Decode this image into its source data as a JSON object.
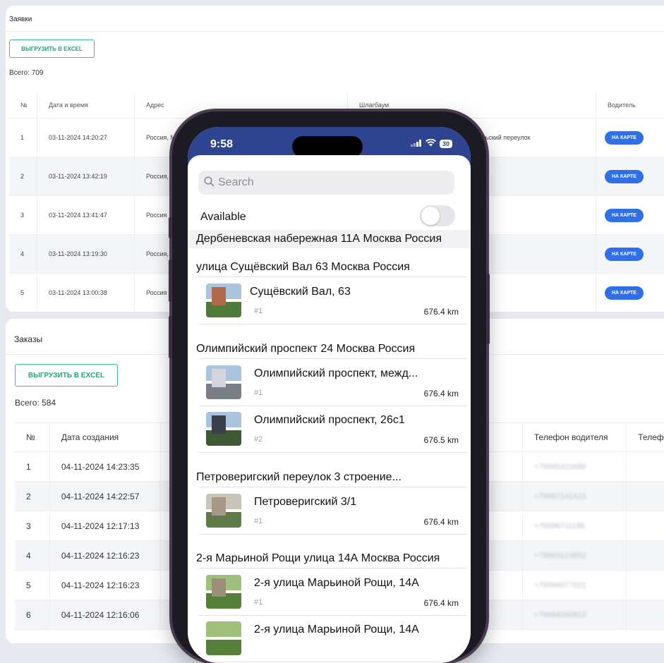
{
  "requests": {
    "title": "Заявки",
    "export_label": "ВЫГРУЗИТЬ В EXCEL",
    "total": "Всего: 709",
    "columns": [
      "№",
      "Дата и время",
      "Адрес",
      "Шлагбаум",
      "Водитель"
    ],
    "rows": [
      {
        "n": "1",
        "date": "03-11-2024 14:20:27",
        "address": "Россия, М",
        "barrier": "Тульский переулок",
        "action": "НА КАРТЕ"
      },
      {
        "n": "2",
        "date": "03-11-2024 13:42:19",
        "address": "Россия,",
        "barrier": "",
        "action": "НА КАРТЕ"
      },
      {
        "n": "3",
        "date": "03-11-2024 13:41:47",
        "address": "Россия",
        "barrier": "",
        "action": "НА КАРТЕ"
      },
      {
        "n": "4",
        "date": "03-11-2024 13:19:30",
        "address": "Россия,",
        "barrier": "",
        "action": "НА КАРТЕ"
      },
      {
        "n": "5",
        "date": "03-11-2024 13:00:38",
        "address": "Россия",
        "barrier": "",
        "action": "НА КАРТЕ"
      }
    ]
  },
  "orders": {
    "title": "Заказы",
    "export_label": "ВЫГРУЗИТЬ В EXCEL",
    "total": "Всего: 584",
    "columns": [
      "№",
      "Дата создания",
      "",
      "Телефон водителя",
      "Телеф"
    ],
    "rows": [
      {
        "n": "1",
        "date": "04-11-2024 14:23:35",
        "phone": "+79995321690"
      },
      {
        "n": "2",
        "date": "04-11-2024 14:22:57",
        "phone": "+79997141415"
      },
      {
        "n": "3",
        "date": "04-11-2024 12:17:13",
        "phone": "+79996711186"
      },
      {
        "n": "4",
        "date": "04-11-2024 12:16:23",
        "phone": "+79993123652"
      },
      {
        "n": "5",
        "date": "04-11-2024 12:16:23",
        "phone": "+79994077022"
      },
      {
        "n": "6",
        "date": "04-11-2024 12:16:06",
        "phone": "+79994260913"
      }
    ]
  },
  "phone": {
    "time": "9:58",
    "battery": "30",
    "search_placeholder": "Search",
    "available_label": "Available",
    "available_on": false,
    "groups": [
      {
        "header": "Дербеневская набережная 11А Москва Россия",
        "items": []
      },
      {
        "header": "улица Сущёвский Вал 63 Москва Россия",
        "items": [
          {
            "title": " Сущёвский Вал, 63",
            "num": "#1",
            "dist": "676.4 km"
          }
        ]
      },
      {
        "header": "Олимпийский проспект 24 Москва Россия",
        "items": [
          {
            "title": "Олимпийский проспект, межд...",
            "num": "#1",
            "dist": "676.4 km"
          },
          {
            "title": "Олимпийский проспект, 26с1",
            "num": "#2",
            "dist": "676.5 km"
          }
        ]
      },
      {
        "header": "Петроверигский переулок 3 строение...",
        "items": [
          {
            "title": "Петроверигский 3/1",
            "num": "#1",
            "dist": "676.4 km"
          }
        ]
      },
      {
        "header": "2-я Марьиной Рощи улица 14А Москва Россия",
        "items": [
          {
            "title": "2-я улица Марьиной Рощи, 14А",
            "num": "#1",
            "dist": "676.4 km"
          },
          {
            "title": "2-я улица Марьиной Рощи, 14А",
            "num": "",
            "dist": ""
          }
        ]
      }
    ]
  },
  "colors": {
    "accent_green": "#34c08a",
    "map_button_blue": "#2f6fe8",
    "status_bar_blue": "#2f4490"
  }
}
